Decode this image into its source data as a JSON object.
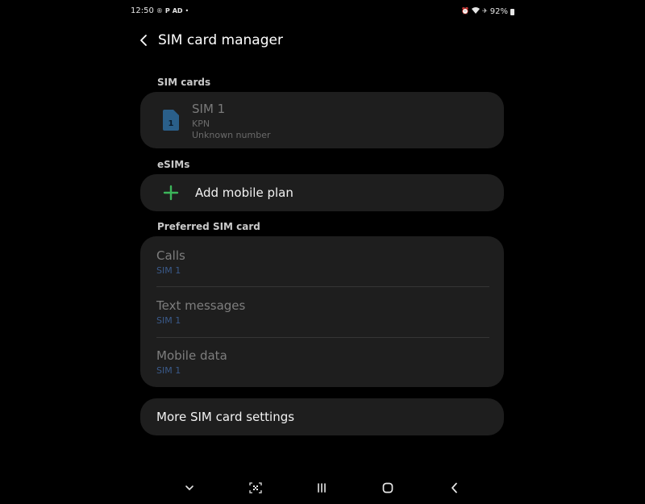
{
  "status_bar": {
    "time": "12:50",
    "left_icons": [
      "registered-icon",
      "paypal-icon",
      "ad-icon",
      "dot-icon"
    ],
    "right_icons": [
      "alarm-icon",
      "wifi-icon",
      "airplane-icon"
    ],
    "battery": "92%"
  },
  "header": {
    "title": "SIM card manager"
  },
  "sections": {
    "sim_cards": "SIM cards",
    "esims": "eSIMs",
    "preferred": "Preferred SIM card"
  },
  "sim": {
    "name": "SIM 1",
    "carrier": "KPN",
    "number": "Unknown number",
    "badge": "1"
  },
  "esim": {
    "add_label": "Add mobile plan"
  },
  "preferred": [
    {
      "title": "Calls",
      "value": "SIM 1"
    },
    {
      "title": "Text messages",
      "value": "SIM 1"
    },
    {
      "title": "Mobile data",
      "value": "SIM 1"
    }
  ],
  "more": {
    "label": "More SIM card settings"
  },
  "colors": {
    "background": "#000000",
    "card": "#1e1e1e",
    "accent_green": "#3cb55a",
    "value_blue": "#3a5a8a",
    "sim_blue": "#2a5f8a"
  },
  "nav_bar": [
    "hide-keyboard-icon",
    "screen-capture-icon",
    "recents-icon",
    "home-icon",
    "back-icon"
  ]
}
